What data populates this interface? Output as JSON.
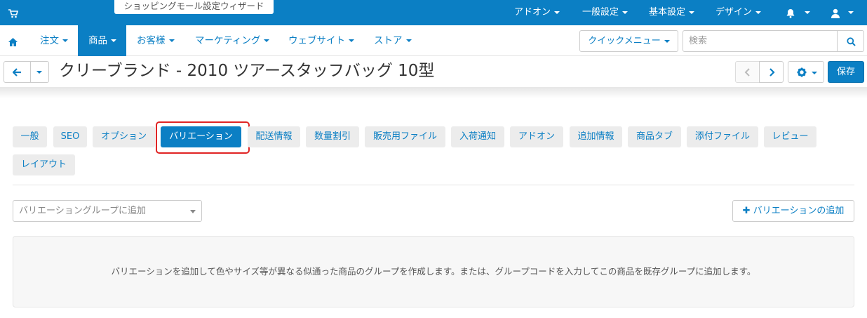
{
  "topbar": {
    "wizard_label": "ショッピングモール設定ウィザード",
    "menus": [
      "アドオン",
      "一般設定",
      "基本設定",
      "デザイン"
    ]
  },
  "mainnav": {
    "items": [
      "注文",
      "商品",
      "お客様",
      "マーケティング",
      "ウェブサイト",
      "ストア"
    ],
    "active_index": 1,
    "quick_menu_label": "クイックメニュー",
    "search_placeholder": "検索"
  },
  "titlebar": {
    "title": "クリーブランド - 2010 ツアースタッフバッグ 10型",
    "save_label": "保存"
  },
  "tabs": [
    "一般",
    "SEO",
    "オプション",
    "バリエーション",
    "配送情報",
    "数量割引",
    "販売用ファイル",
    "入荷通知",
    "アドオン",
    "追加情報",
    "商品タブ",
    "添付ファイル",
    "レビュー",
    "レイアウト"
  ],
  "active_tab": "バリエーション",
  "variations": {
    "group_select_placeholder": "バリエーショングループに追加",
    "add_button_label": "バリエーションの追加",
    "empty_message": "バリエーションを追加して色やサイズ等が異なる似通った商品のグループを作成します。または、グループコードを入力してこの商品を既存グループに追加します。"
  },
  "colors": {
    "primary": "#0b7fc4",
    "highlight": "#e02424",
    "tab_bg": "#ececec"
  }
}
